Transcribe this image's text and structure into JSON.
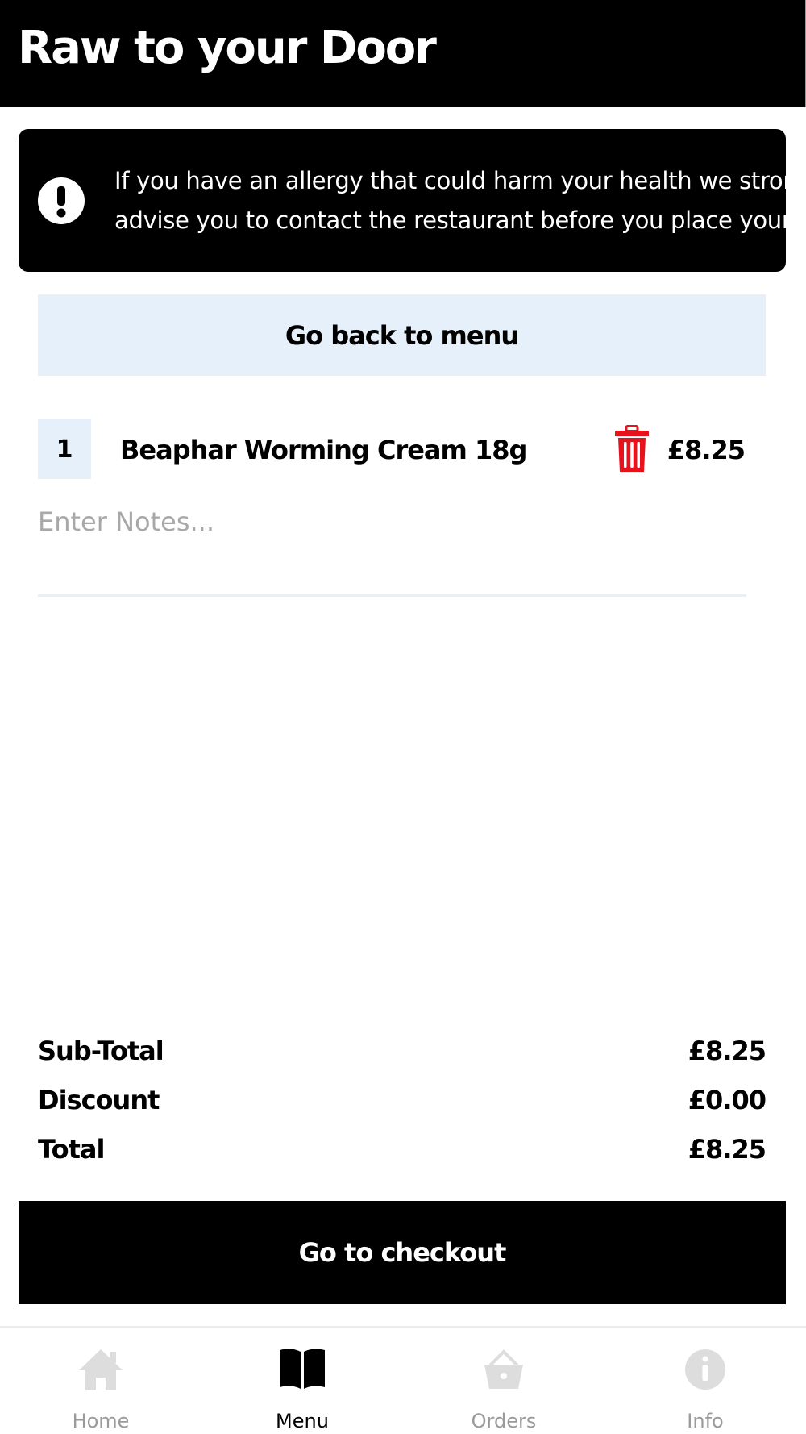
{
  "header": {
    "title": "Raw to your Door"
  },
  "allergy_notice": {
    "icon": "exclamation-circle-icon",
    "line1": "If you have an allergy that could harm your health we strongly",
    "line2": "advise you to contact the restaurant before you place your order"
  },
  "back_button": {
    "label": "Go back to menu"
  },
  "basket": {
    "items": [
      {
        "quantity": "1",
        "name": "Beaphar Worming Cream 18g",
        "price": "£8.25",
        "remove_icon": "trash-icon"
      }
    ],
    "notes_placeholder": "Enter Notes..."
  },
  "summary": {
    "subtotal_label": "Sub-Total",
    "subtotal_value": "£8.25",
    "discount_label": "Discount",
    "discount_value": "£0.00",
    "total_label": "Total",
    "total_value": "£8.25"
  },
  "checkout_button": {
    "label": "Go to checkout"
  },
  "tabs": [
    {
      "label": "Home",
      "icon": "home-icon",
      "active": false
    },
    {
      "label": "Menu",
      "icon": "book-icon",
      "active": true
    },
    {
      "label": "Orders",
      "icon": "basket-icon",
      "active": false
    },
    {
      "label": "Info",
      "icon": "info-icon",
      "active": false
    }
  ],
  "colors": {
    "header_bg": "#000000",
    "accent_light": "#e6f0fb",
    "trash_red": "#e8121c",
    "inactive_tab": "#dddddd"
  }
}
